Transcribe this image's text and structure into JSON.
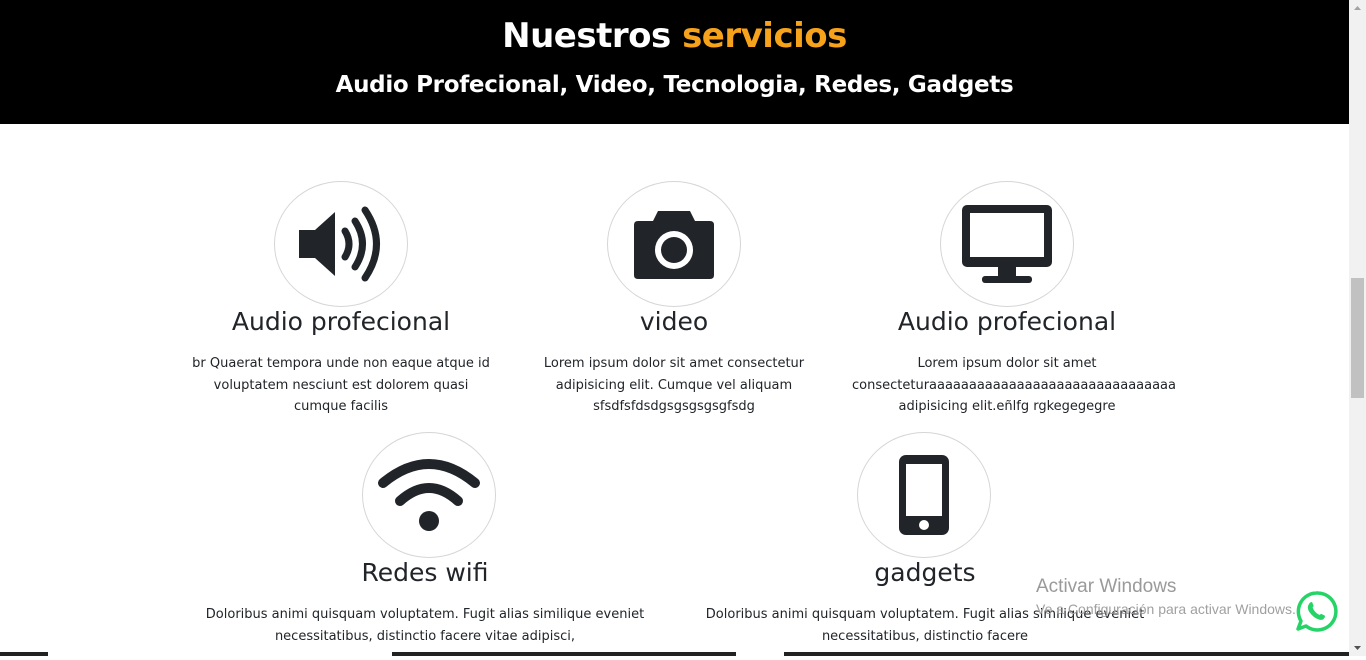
{
  "header": {
    "title_main": "Nuestros",
    "title_accent": "servicios",
    "subtitle": "Audio Profecional, Video, Tecnologia, Redes, Gadgets"
  },
  "services": [
    {
      "icon": "speaker-icon",
      "title": "Audio profecional",
      "description": "br Quaerat tempora unde non eaque atque id voluptatem nesciunt est dolorem quasi cumque facilis"
    },
    {
      "icon": "camera-icon",
      "title": "video",
      "description": "Lorem ipsum dolor sit amet consectetur adipisicing elit. Cumque vel aliquam sfsdfsfdsdgsgsgsgsgfsdg"
    },
    {
      "icon": "desktop-icon",
      "title": "Audio profecional",
      "description": "Lorem ipsum dolor sit amet consecteturaaaaaaaaaaaaaaaaaaaaaaaaaaaaaaa adipisicing elit.eñlfg rgkegegegre"
    },
    {
      "icon": "wifi-icon",
      "title": "Redes wifi",
      "description": "Doloribus animi quisquam voluptatem. Fugit alias similique eveniet necessitatibus, distinctio facere vitae adipisci,"
    },
    {
      "icon": "mobile-phone-icon",
      "title": "gadgets",
      "description": "Doloribus animi quisquam voluptatem. Fugit alias similique eveniet necessitatibus, distinctio facere"
    }
  ],
  "watermark": {
    "line1": "Activar Windows",
    "line2": "Ve a Configuración para activar Windows."
  },
  "floating": {
    "icon": "whatsapp-icon"
  },
  "colors": {
    "accent": "#f7a21b",
    "header_bg": "#000000",
    "icon": "#212529",
    "whatsapp": "#25d366"
  }
}
